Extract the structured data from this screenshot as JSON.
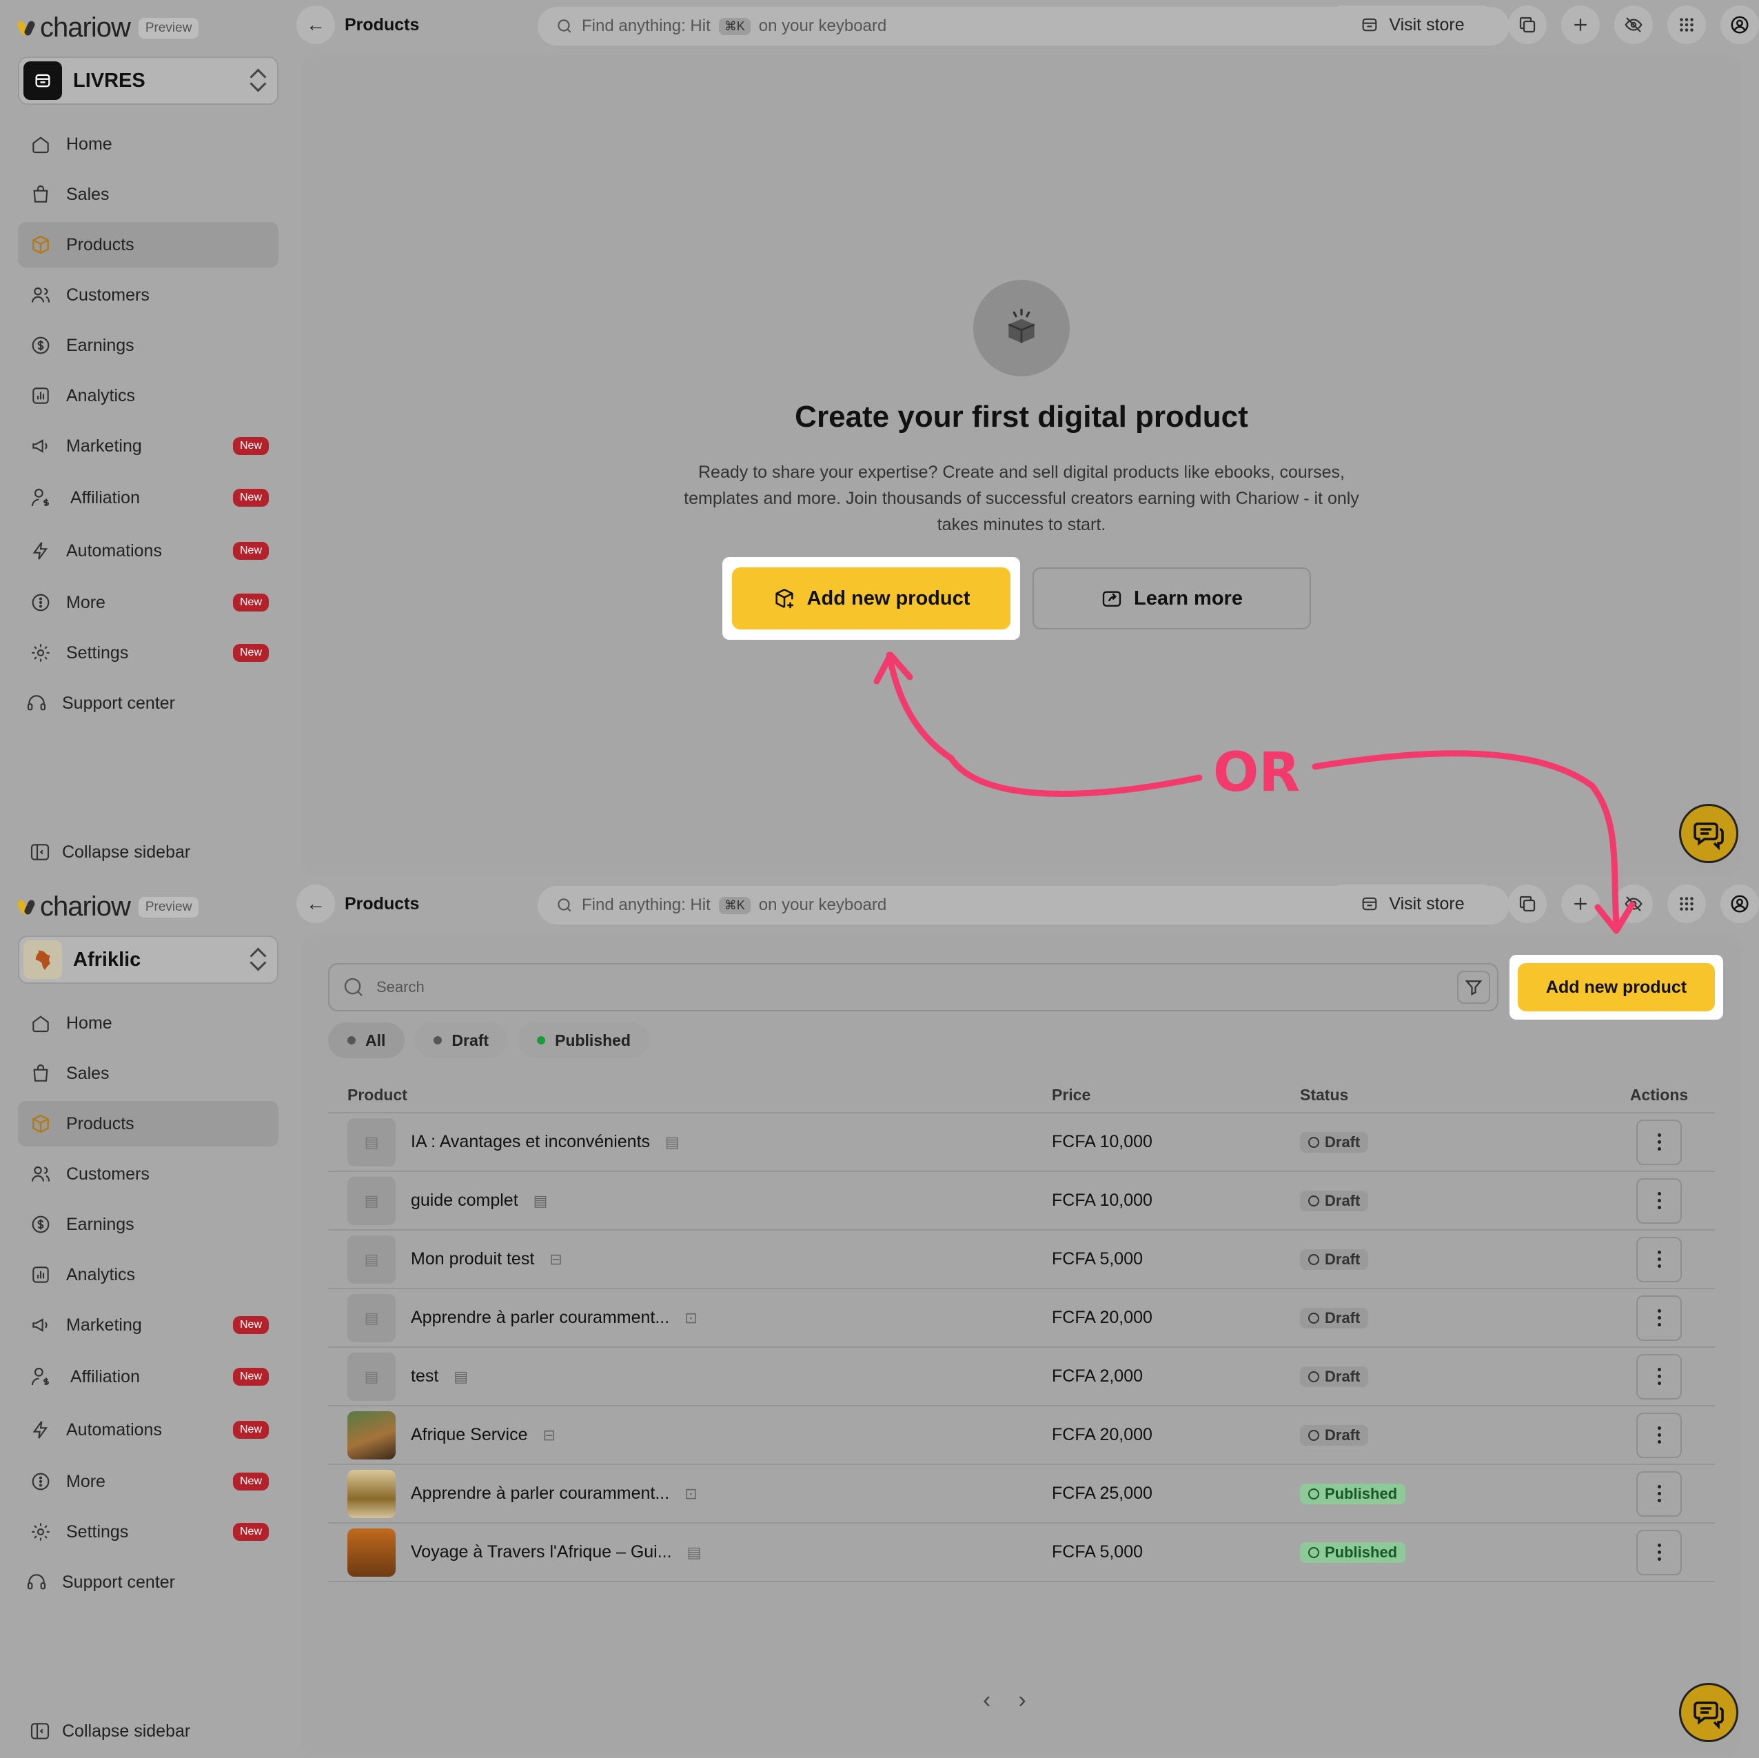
{
  "brand": {
    "name": "chariow",
    "tag": "Preview"
  },
  "top": {
    "store": "LIVRES",
    "crumb": "Products",
    "search_prefix": "Find anything: Hit",
    "search_kbd": "⌘K",
    "search_suffix": "on your keyboard",
    "visit": "Visit store",
    "empty_title": "Create your first digital product",
    "empty_desc": "Ready to share your expertise? Create and sell digital products like ebooks, courses, templates and more. Join thousands of successful creators earning with Chariow - it only takes minutes to start.",
    "add_btn": "Add new product",
    "learn_btn": "Learn more"
  },
  "bottom": {
    "store": "Afriklic",
    "crumb": "Products",
    "search_prefix": "Find anything: Hit",
    "search_kbd": "⌘K",
    "search_suffix": "on your keyboard",
    "visit": "Visit store",
    "list_search_placeholder": "Search",
    "add_btn": "Add new product",
    "filters": [
      "All",
      "Draft",
      "Published"
    ],
    "columns": {
      "product": "Product",
      "price": "Price",
      "status": "Status",
      "actions": "Actions"
    },
    "rows": [
      {
        "name": "IA : Avantages et inconvénients",
        "price": "FCFA 10,000",
        "status": "Draft"
      },
      {
        "name": "guide complet",
        "price": "FCFA 10,000",
        "status": "Draft"
      },
      {
        "name": "Mon produit test",
        "price": "FCFA 5,000",
        "status": "Draft"
      },
      {
        "name": "Apprendre à parler couramment...",
        "price": "FCFA 20,000",
        "status": "Draft"
      },
      {
        "name": "test",
        "price": "FCFA 2,000",
        "status": "Draft"
      },
      {
        "name": "Afrique Service",
        "price": "FCFA 20,000",
        "status": "Draft"
      },
      {
        "name": "Apprendre à parler couramment...",
        "price": "FCFA 25,000",
        "status": "Published"
      },
      {
        "name": "Voyage à Travers l'Afrique – Gui...",
        "price": "FCFA 5,000",
        "status": "Published"
      }
    ]
  },
  "nav": {
    "home": "Home",
    "sales": "Sales",
    "products": "Products",
    "customers": "Customers",
    "earnings": "Earnings",
    "analytics": "Analytics",
    "marketing": "Marketing",
    "affiliation": "Affiliation",
    "automations": "Automations",
    "more": "More",
    "settings": "Settings",
    "support": "Support center",
    "collapse": "Collapse sidebar",
    "new_badge": "New"
  },
  "annotation": {
    "or": "OR",
    "color": "#f23b6c"
  },
  "colors": {
    "accent": "#f7c52b",
    "badge": "#b3222a"
  }
}
